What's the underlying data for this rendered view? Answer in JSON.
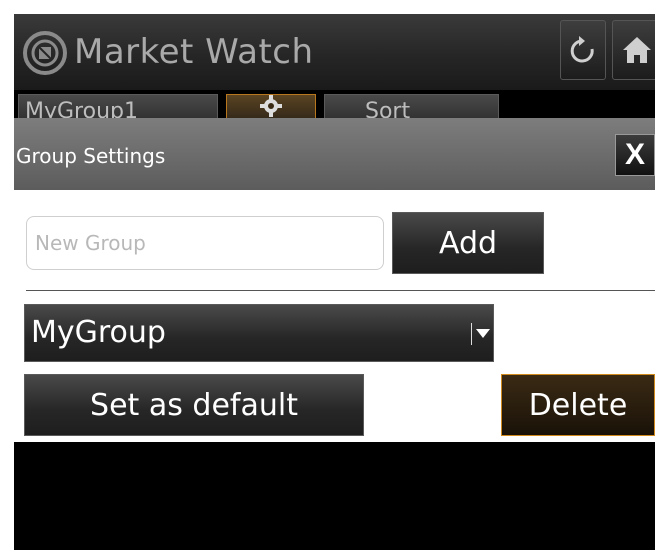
{
  "app": {
    "title": "Market Watch",
    "logo_icon": "market-watch-logo-icon",
    "header_buttons": [
      {
        "name": "refresh-icon"
      },
      {
        "name": "home-icon"
      }
    ]
  },
  "tabs": {
    "group_label": "MyGroup1",
    "gear_icon": "gear-icon",
    "sort_label": "Sort"
  },
  "dialog": {
    "title": "Group Settings",
    "close_label": "X",
    "new_group_placeholder": "New Group",
    "new_group_value": "",
    "add_label": "Add",
    "selected_group": "MyGroup",
    "set_default_label": "Set as default",
    "delete_label": "Delete"
  },
  "colors": {
    "accent_orange": "#d08a1e",
    "dialog_title_bg": "#6e6e6e",
    "button_dark": "#262626",
    "header_text": "#a9a9a9"
  }
}
